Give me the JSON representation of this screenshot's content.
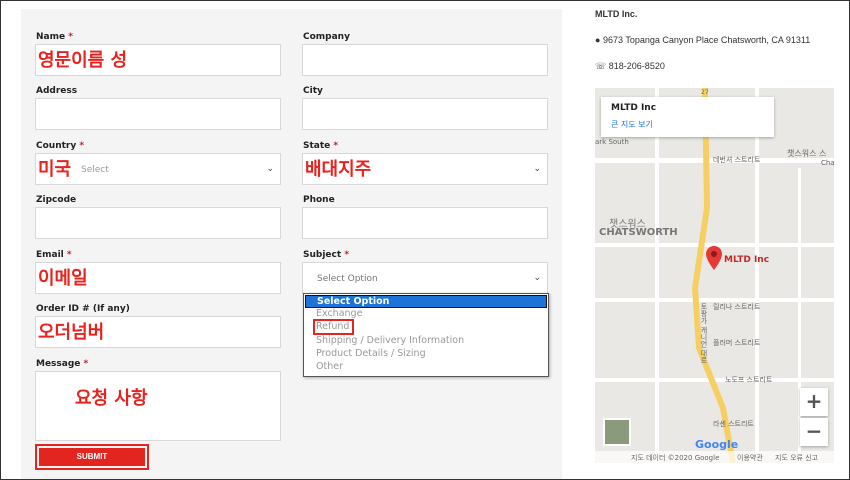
{
  "form": {
    "name_label": "Name",
    "company_label": "Company",
    "address_label": "Address",
    "city_label": "City",
    "country_label": "Country",
    "country_value": "Select",
    "state_label": "State",
    "zipcode_label": "Zipcode",
    "phone_label": "Phone",
    "email_label": "Email",
    "subject_label": "Subject",
    "subject_value": "Select Option",
    "order_label": "Order ID # (If any)",
    "message_label": "Message",
    "required_mark": "*",
    "submit_label": "SUBMIT"
  },
  "subject_options": [
    "Select Option",
    "Exchange",
    "Refund",
    "Shipping / Delivery Information",
    "Product Details / Sizing",
    "Other"
  ],
  "annotations": {
    "name": "영문이름 성",
    "country": "미국",
    "state": "배대지주",
    "email": "이메일",
    "order": "오더넘버",
    "message": "요청 사항"
  },
  "company": {
    "name": "MLTD Inc.",
    "address": "9673 Topanga Canyon Place Chatsworth, CA 91311",
    "phone": "818-206-8520"
  },
  "map": {
    "place": "MLTD Inc",
    "view_larger": "큰 지도 보기",
    "marker_label": "MLTD Inc",
    "area_kr": "챗스워스",
    "area_en": "CHATSWORTH",
    "park": "ark South",
    "street1": "데번셔 스트리트",
    "street2": "릴리나 스트리트",
    "street3": "플러머 스트리트",
    "street4": "노도프 스트리트",
    "street5": "라센 스트리트",
    "topanga": "토팡가 캐니언 대로",
    "corner1": "챗스워스 스",
    "corner2": "Cha",
    "route_badge": "27",
    "zoom_in": "+",
    "zoom_out": "−",
    "google": "Google",
    "footer_data": "지도 데이터 ©2020 Google",
    "footer_terms": "이용약관",
    "footer_report": "지도 오류 신고"
  },
  "colors": {
    "accent": "#e32520",
    "highlight": "#1e74d6"
  }
}
